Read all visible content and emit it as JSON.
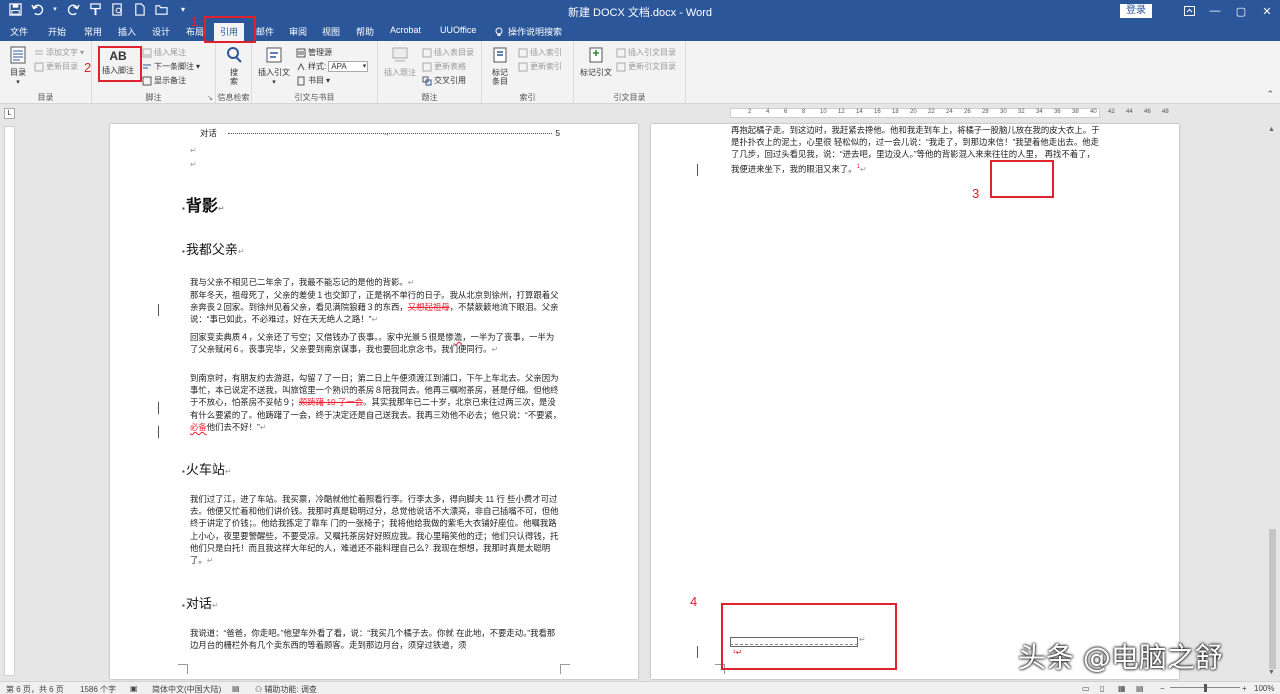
{
  "window": {
    "title": "新建 DOCX 文档.docx - Word",
    "login": "登录",
    "controls": [
      "—",
      "▢",
      "✕"
    ]
  },
  "tabs": [
    "文件",
    "开始",
    "常用",
    "插入",
    "设计",
    "布局",
    "引用",
    "邮件",
    "审阅",
    "视图",
    "帮助",
    "Acrobat",
    "UUOffice",
    "操作说明搜索"
  ],
  "active_tab": "引用",
  "ribbon": {
    "toc": {
      "big": "目录",
      "add_text": "添加文字",
      "update": "更新目录",
      "label": "目录"
    },
    "footnote": {
      "insert_footnote_icon": "AB",
      "insert_footnote": "插入脚注",
      "insert_endnote": "插入尾注",
      "next_footnote": "下一条脚注",
      "show_notes": "显示备注",
      "label": "脚注"
    },
    "research": {
      "search": "搜索",
      "label": "信息检索"
    },
    "citations": {
      "insert_citation": "插入引文",
      "manage_sources": "管理源",
      "style_label": "样式:",
      "style_value": "APA",
      "bibliography": "书目",
      "label": "引文与书目"
    },
    "captions": {
      "insert_caption": "插入题注",
      "insert_table_of_figures": "插入表目录",
      "update_table": "更新表格",
      "cross_reference": "交叉引用",
      "label": "题注"
    },
    "index": {
      "mark_entry": "标记条目",
      "insert_index": "插入索引",
      "update_index": "更新索引",
      "label": "索引"
    },
    "toa": {
      "mark_citation": "标记引文",
      "insert_toa": "插入引文目录",
      "update_toa": "更新引文目录",
      "label": "引文目录"
    }
  },
  "ruler": {
    "numbers": [
      "2",
      "4",
      "6",
      "8",
      "10",
      "12",
      "14",
      "16",
      "18",
      "20",
      "22",
      "24",
      "26",
      "28",
      "30",
      "32",
      "34",
      "36",
      "38",
      "40",
      "42",
      "44",
      "46",
      "48"
    ],
    "corner": "L"
  },
  "left_page": {
    "toc_entry": "对话",
    "toc_page": "5",
    "title": "背影",
    "sections": [
      {
        "heading": "我都父亲",
        "paragraphs": [
          [
            "我与父亲不相见已二年余了，我最不能忘记的是他的背影。"
          ],
          [
            "那年冬天，祖母死了，父亲的差使１也交卸了，正是祸不单行的日子。我从北京到徐州，打算跟着父亲奔丧２回家。到徐州见着父亲，看见满院狼藉３的东西，",
            "又想起祖母",
            "，不禁簌簌地流下眼泪。父亲说：“事已如此，不必难过，好在天无绝人之路！”"
          ],
          [
            "回家变卖典质４，父亲还了亏空；又借钱办了丧事。。家中光景５很是惨",
            "澹",
            "，一半为了丧事，一半为了父亲赋闲６。丧事完毕，父亲要到南京谋事，我也要回北京念书，我们便同行。"
          ],
          [
            "到南京时，有朋友约去游逛，勾留７了一日；第二日上午便须渡江到浦口，下午上车北去。父亲因为事忙，本已说定不送我，叫旅馆里一个熟识的茶房８陪我同去。他再三嘱咐茶房，甚是仔细。但他终于不放心，怕茶房不妥帖９；",
            "颇踌躇 10 了一会",
            "。其实我那年已二十岁，北京已来往过两三次，是没有什么要紧的了。他踌躇了一会，终于决定还是自己送我去。我再三劝他不必去；他只说：“不要紧，",
            "必备",
            "他们去不好！”"
          ]
        ]
      },
      {
        "heading": "火车站",
        "paragraphs": [
          [
            "我们过了江，进了车站。我买票，冷酷就他忙着照看行李。行李太多，得向脚夫 11 行 些小费才可过去。他便又忙着和他们讲价钱。我那时真是聪明过分，总觉他说话不大漂亮，非自己插嘴不可，但他终于讲定了价钱；。他给我拣定了靠车 门的一张椅子；我将他给我做的紫毛大衣铺好座位。他嘱我路上小心，夜里要警醒些，不要受凉。又嘱托茶房好好照应我。我心里暗笑他的迂；他们只认得钱，托他们只是白托！而且我这样大年纪的人，难道还不能料理自己么？我现在想想，我那时真是太聪明了。"
          ]
        ]
      },
      {
        "heading": "对话",
        "paragraphs": [
          [
            "我说道：“爸爸，你走吧。”他望车外看了看，说：“我买几个橘子去。你就 在此地，不要走动。”我看那边月台的栅栏外有几个卖东西的等着顾客。走到那边月台，须穿过铁道，须"
          ]
        ]
      }
    ]
  },
  "right_page": {
    "paragraph": "再抱起橘子走。到这边时，我赶紧去搀他。他和我走到车上，将橘子一股脑儿放在我的皮大衣上。于是扑扑衣上的泥土，心里很 轻松似的，过一会儿说：“我走了，到那边来信！”我望着他走出去。他走了几步，回过头看见我，说：“进去吧，里边没人。”等他的背影混入来来往往的人里， 再找不着了，我便进来坐下，我的眼泪又来了。",
    "footnote_mark": "1"
  },
  "annotations": [
    "1",
    "2",
    "3",
    "4"
  ],
  "statusbar": {
    "page": "第 6 页，共 6 页",
    "words": "1586 个字",
    "language": "简体中文(中国大陆)",
    "accessibility": "辅助功能: 调查",
    "zoom": "100%"
  },
  "watermark": "头条 @电脑之舒",
  "colors": {
    "word_blue": "#2b579a",
    "annotation_red": "#e0222c",
    "ribbon_bg": "#f3f3f3"
  }
}
